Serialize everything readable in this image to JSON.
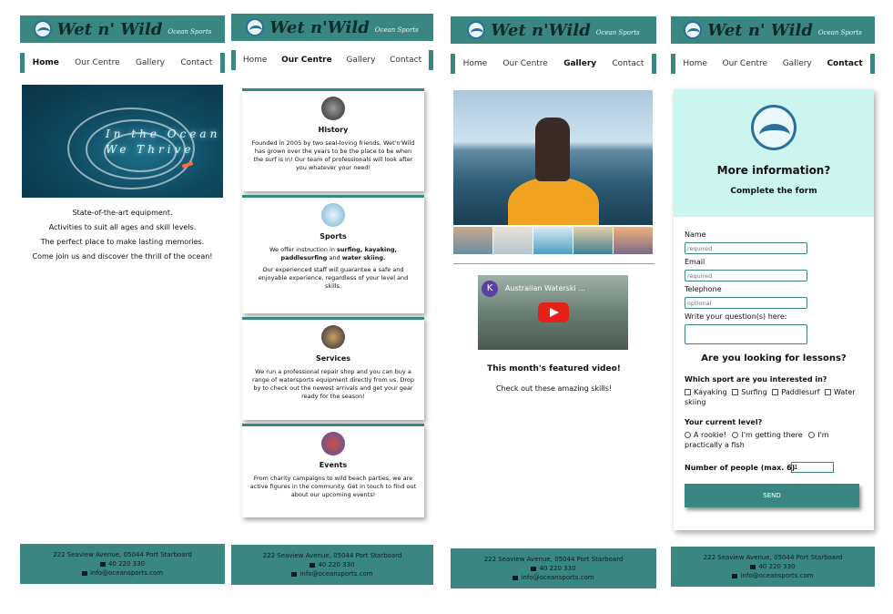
{
  "brand": {
    "name": "Wet n' Wild",
    "tagline": "Ocean Sports"
  },
  "brand_alt": {
    "name": "Wet n'Wild"
  },
  "nav": [
    "Home",
    "Our Centre",
    "Gallery",
    "Contact"
  ],
  "footer": {
    "address": "222 Seaview Avenue, 05044 Port Starboard",
    "phone": "40 220 330",
    "email": "info@oceansports.com"
  },
  "home": {
    "hero_line1": "In the Ocean",
    "hero_line2": "We Thrive",
    "lines": [
      "State-of-the-art equipment.",
      "Activities to suit all ages and skill levels.",
      "The perfect place to make lasting memories.",
      "Come join us and discover the thrill of the ocean!"
    ]
  },
  "centre": {
    "cards": [
      {
        "title": "History",
        "text": "Founded in 2005 by two seal-loving friends, Wet'n'Wild has grown over the years to be the place to be when the surf is in! Our team of professionals will look after you whatever your need!"
      },
      {
        "title": "Sports",
        "text_a": "We offer instruction in ",
        "text_b": "surfing, kayaking, paddlesurfing",
        "text_c": " and ",
        "text_d": "water skiing.",
        "text2": "Our experienced staff will guarantee a safe and enjoyable experience, regardless of your level and skills."
      },
      {
        "title": "Services",
        "text": "We run a professional repair shop and you can buy a range of watersports equipment directly from us. Drop by to check out the newest arrivals and get your gear ready for the season!"
      },
      {
        "title": "Events",
        "text": "From charity campaigns to wild beach parties, we are active figures in the community. Get in touch to find out about our upcoming events!"
      }
    ]
  },
  "gallery": {
    "video_channel_initial": "K",
    "video_title": "Australian Waterski ...",
    "featured_title": "This month's featured video!",
    "featured_text": "Check out these amazing skills!"
  },
  "contact": {
    "title": "More information?",
    "subtitle": "Complete the form",
    "fields": [
      {
        "label": "Name",
        "placeholder": "required"
      },
      {
        "label": "Email",
        "placeholder": "required"
      },
      {
        "label": "Telephone",
        "placeholder": "optional"
      },
      {
        "label": "Write your question(s) here:",
        "placeholder": ""
      }
    ],
    "lessons_heading": "Are you looking for lessons?",
    "sport_question": "Which sport are you interested in?",
    "sports": [
      "Kayaking",
      "Surfing",
      "Paddlesurf",
      "Water skiing"
    ],
    "level_question": "Your current level?",
    "levels": [
      "A rookie!",
      "I'm getting there",
      "I'm practically a fish"
    ],
    "people_label": "Number of people (max. 6)",
    "people_value": "1",
    "send_label": "SEND"
  },
  "colors": {
    "accent": "#3a8782",
    "form_top": "#cbf5ee"
  }
}
